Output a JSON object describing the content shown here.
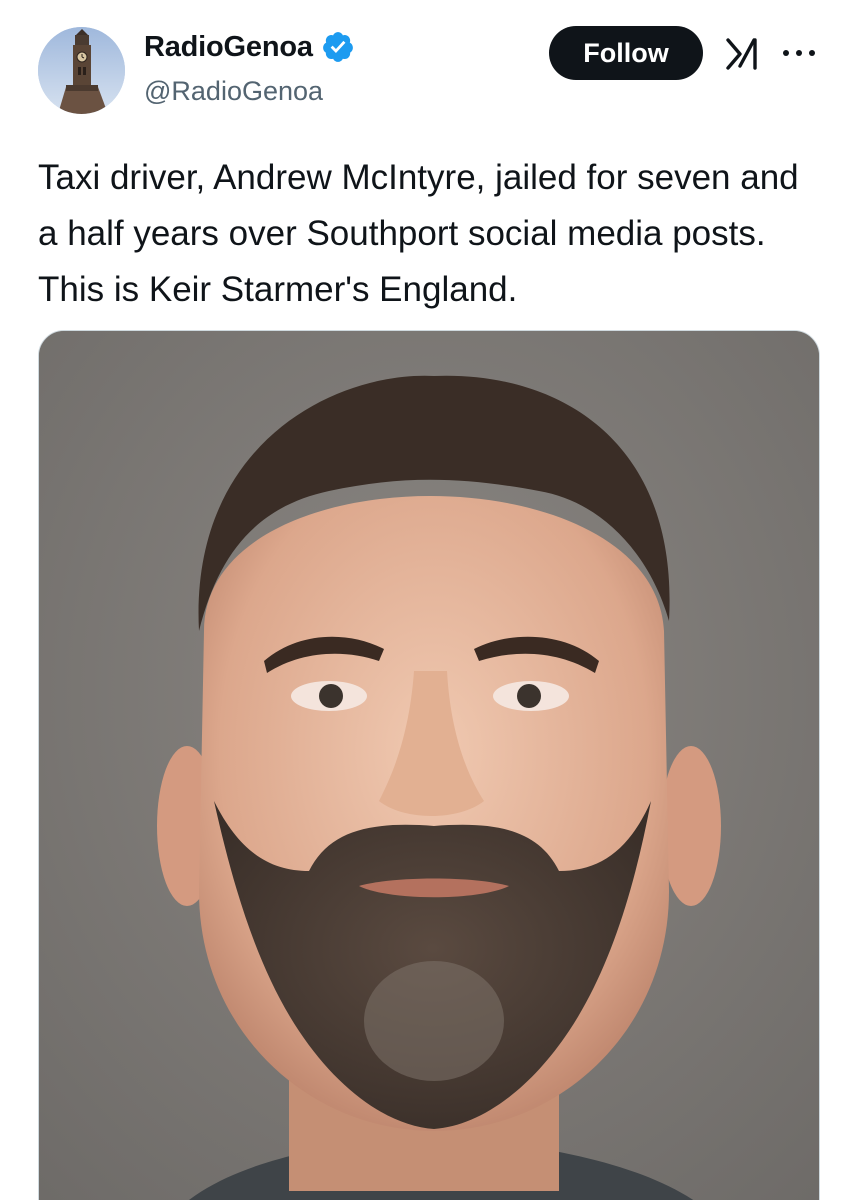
{
  "author": {
    "display_name": "RadioGenoa",
    "handle": "@RadioGenoa",
    "verified": true,
    "avatar_icon": "clock-tower-avatar"
  },
  "actions": {
    "follow_label": "Follow",
    "grok_icon": "grok-icon",
    "more_icon": "more-icon"
  },
  "post": {
    "text": "Taxi driver, Andrew McIntyre, jailed for seven and a half years over Southport social media posts. This is Keir Starmer's England."
  },
  "media": {
    "type": "photo",
    "icon": "mugshot-photo"
  },
  "colors": {
    "verified_blue": "#1d9bf0",
    "follow_bg": "#0f1419",
    "handle_gray": "#536471"
  }
}
